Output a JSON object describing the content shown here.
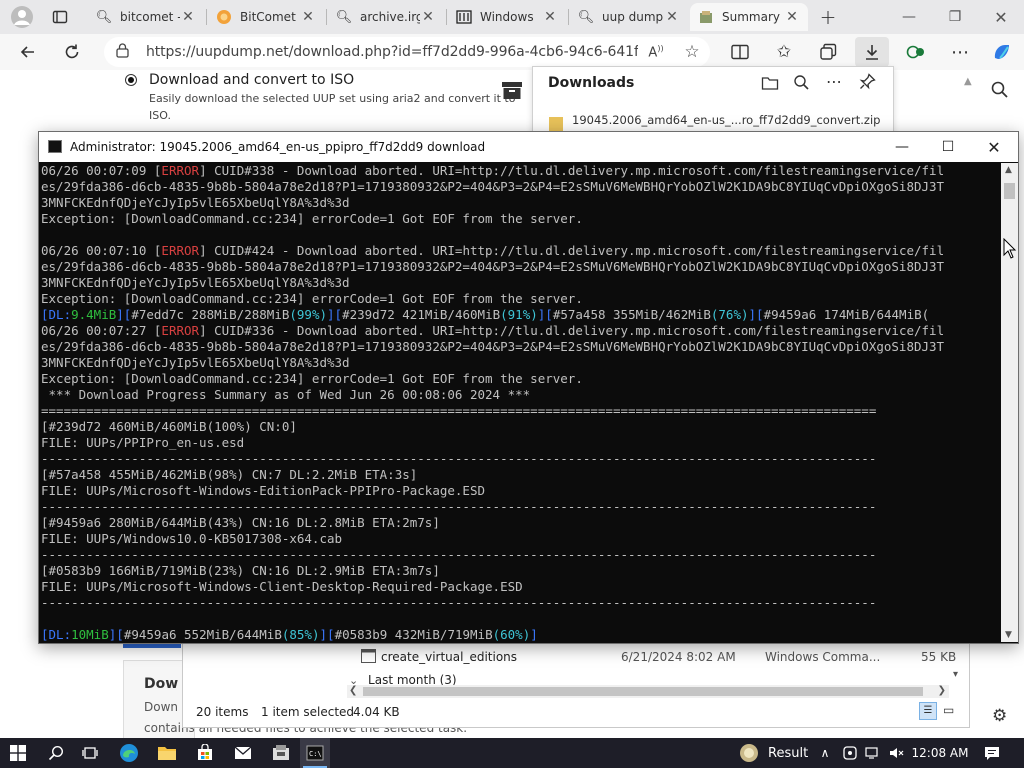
{
  "browser": {
    "tabs": [
      {
        "label": "bitcomet -",
        "icon": "search-icon"
      },
      {
        "label": "BitComet",
        "icon": "bitcomet-icon"
      },
      {
        "label": "archive.irg",
        "icon": "search-icon"
      },
      {
        "label": "Windows",
        "icon": "archive-icon"
      },
      {
        "label": "uup dump",
        "icon": "search-icon"
      },
      {
        "label": "Summary",
        "icon": "uupdump-icon"
      }
    ],
    "url": "https://uupdump.net/download.php?id=ff7d2dd9-996a-4cb6-94c6-641f45c..."
  },
  "webpage": {
    "option_title": "Download and convert to ISO",
    "option_desc_1": "Easily download the selected UUP set using aria2 and convert it to",
    "option_desc_2": "ISO.",
    "card_title": "Dow",
    "card_text_1": "Down",
    "card_text_2": "contains all needed files to achieve the selected task."
  },
  "downloads_panel": {
    "title": "Downloads",
    "item": "19045.2006_amd64_en-us_...ro_ff7d2dd9_convert.zip"
  },
  "explorer": {
    "file_name": "create_virtual_editions",
    "file_date": "6/21/2024 8:02 AM",
    "file_type": "Windows Comma...",
    "file_size": "55 KB",
    "group": "Last month (3)",
    "items_count": "20 items",
    "selected": "1 item selected",
    "selected_size": "4.04 KB"
  },
  "console": {
    "title": "Administrator:  19045.2006_amd64_en-us_ppipro_ff7d2dd9 download",
    "lines": [
      [
        {
          "t": "06/26 00:07:09 ["
        },
        {
          "t": "ERROR",
          "c": "err"
        },
        {
          "t": "] CUID#338 - Download aborted. URI=http://tlu.dl.delivery.mp.microsoft.com/filestreamingservice/fil"
        }
      ],
      [
        {
          "t": "es/29fda386-d6cb-4835-9b8b-5804a78e2d18?P1=1719380932&P2=404&P3=2&P4=E2sSMuV6MeWBHQrYobOZlW2K1DA9bC8YIUqCvDpiOXgoSi8DJ3T"
        }
      ],
      [
        {
          "t": "3MNFCKEdnfQDjeYcJyIp5vlE65XbeUqlY8A%3d%3d"
        }
      ],
      [
        {
          "t": "Exception: [DownloadCommand.cc:234] errorCode=1 Got EOF from the server."
        }
      ],
      [
        {
          "t": ""
        }
      ],
      [
        {
          "t": "06/26 00:07:10 ["
        },
        {
          "t": "ERROR",
          "c": "err"
        },
        {
          "t": "] CUID#424 - Download aborted. URI=http://tlu.dl.delivery.mp.microsoft.com/filestreamingservice/fil"
        }
      ],
      [
        {
          "t": "es/29fda386-d6cb-4835-9b8b-5804a78e2d18?P1=1719380932&P2=404&P3=2&P4=E2sSMuV6MeWBHQrYobOZlW2K1DA9bC8YIUqCvDpiOXgoSi8DJ3T"
        }
      ],
      [
        {
          "t": "3MNFCKEdnfQDjeYcJyIp5vlE65XbeUqlY8A%3d%3d"
        }
      ],
      [
        {
          "t": "Exception: [DownloadCommand.cc:234] errorCode=1 Got EOF from the server."
        }
      ],
      [
        {
          "t": "[",
          "c": "blu"
        },
        {
          "t": "DL:",
          "c": "blu"
        },
        {
          "t": "9.4MiB",
          "c": "grn"
        },
        {
          "t": "][",
          "c": "blu"
        },
        {
          "t": "#7edd7c 288MiB/288MiB"
        },
        {
          "t": "(99%)",
          "c": "cyn"
        },
        {
          "t": "][",
          "c": "blu"
        },
        {
          "t": "#239d72 421MiB/460MiB"
        },
        {
          "t": "(91%)",
          "c": "cyn"
        },
        {
          "t": "][",
          "c": "blu"
        },
        {
          "t": "#57a458 355MiB/462MiB"
        },
        {
          "t": "(76%)",
          "c": "cyn"
        },
        {
          "t": "][",
          "c": "blu"
        },
        {
          "t": "#9459a6 174MiB/644MiB("
        }
      ],
      [
        {
          "t": "06/26 00:07:27 ["
        },
        {
          "t": "ERROR",
          "c": "err"
        },
        {
          "t": "] CUID#336 - Download aborted. URI=http://tlu.dl.delivery.mp.microsoft.com/filestreamingservice/fil"
        }
      ],
      [
        {
          "t": "es/29fda386-d6cb-4835-9b8b-5804a78e2d18?P1=1719380932&P2=404&P3=2&P4=E2sSMuV6MeWBHQrYobOZlW2K1DA9bC8YIUqCvDpiOXgoSi8DJ3T"
        }
      ],
      [
        {
          "t": "3MNFCKEdnfQDjeYcJyIp5vlE65XbeUqlY8A%3d%3d"
        }
      ],
      [
        {
          "t": "Exception: [DownloadCommand.cc:234] errorCode=1 Got EOF from the server."
        }
      ],
      [
        {
          "t": " *** Download Progress Summary as of Wed Jun 26 00:08:06 2024 ***"
        }
      ],
      [
        {
          "t": "==============================================================================================================="
        }
      ],
      [
        {
          "t": "[#239d72 460MiB/460MiB(100%) CN:0]"
        }
      ],
      [
        {
          "t": "FILE: UUPs/PPIPro_en-us.esd"
        }
      ],
      [
        {
          "t": "---------------------------------------------------------------------------------------------------------------"
        }
      ],
      [
        {
          "t": "[#57a458 455MiB/462MiB(98%) CN:7 DL:2.2MiB ETA:3s]"
        }
      ],
      [
        {
          "t": "FILE: UUPs/Microsoft-Windows-EditionPack-PPIPro-Package.ESD"
        }
      ],
      [
        {
          "t": "---------------------------------------------------------------------------------------------------------------"
        }
      ],
      [
        {
          "t": "[#9459a6 280MiB/644MiB(43%) CN:16 DL:2.8MiB ETA:2m7s]"
        }
      ],
      [
        {
          "t": "FILE: UUPs/Windows10.0-KB5017308-x64.cab"
        }
      ],
      [
        {
          "t": "---------------------------------------------------------------------------------------------------------------"
        }
      ],
      [
        {
          "t": "[#0583b9 166MiB/719MiB(23%) CN:16 DL:2.9MiB ETA:3m7s]"
        }
      ],
      [
        {
          "t": "FILE: UUPs/Microsoft-Windows-Client-Desktop-Required-Package.ESD"
        }
      ],
      [
        {
          "t": "---------------------------------------------------------------------------------------------------------------"
        }
      ],
      [
        {
          "t": ""
        }
      ],
      [
        {
          "t": "[",
          "c": "blu"
        },
        {
          "t": "DL:",
          "c": "blu"
        },
        {
          "t": "10MiB",
          "c": "grn"
        },
        {
          "t": "][",
          "c": "blu"
        },
        {
          "t": "#9459a6 552MiB/644MiB"
        },
        {
          "t": "(85%)",
          "c": "cyn"
        },
        {
          "t": "][",
          "c": "blu"
        },
        {
          "t": "#0583b9 432MiB/719MiB"
        },
        {
          "t": "(60%)",
          "c": "cyn"
        },
        {
          "t": "]",
          "c": "blu"
        }
      ]
    ]
  },
  "taskbar": {
    "weather": "Result",
    "time": "12:08 AM"
  }
}
